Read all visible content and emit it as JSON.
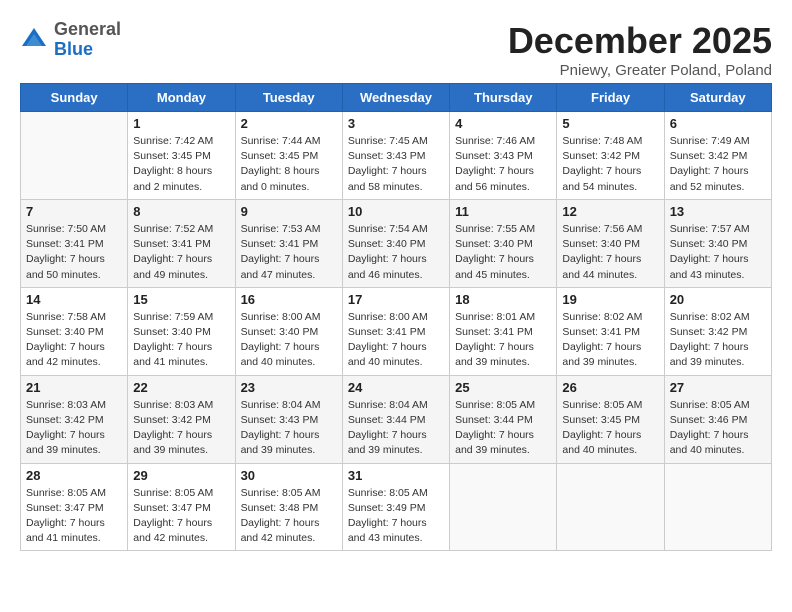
{
  "logo": {
    "general": "General",
    "blue": "Blue"
  },
  "header": {
    "month": "December 2025",
    "location": "Pniewy, Greater Poland, Poland"
  },
  "weekdays": [
    "Sunday",
    "Monday",
    "Tuesday",
    "Wednesday",
    "Thursday",
    "Friday",
    "Saturday"
  ],
  "weeks": [
    [
      {
        "day": "",
        "info": ""
      },
      {
        "day": "1",
        "info": "Sunrise: 7:42 AM\nSunset: 3:45 PM\nDaylight: 8 hours\nand 2 minutes."
      },
      {
        "day": "2",
        "info": "Sunrise: 7:44 AM\nSunset: 3:45 PM\nDaylight: 8 hours\nand 0 minutes."
      },
      {
        "day": "3",
        "info": "Sunrise: 7:45 AM\nSunset: 3:43 PM\nDaylight: 7 hours\nand 58 minutes."
      },
      {
        "day": "4",
        "info": "Sunrise: 7:46 AM\nSunset: 3:43 PM\nDaylight: 7 hours\nand 56 minutes."
      },
      {
        "day": "5",
        "info": "Sunrise: 7:48 AM\nSunset: 3:42 PM\nDaylight: 7 hours\nand 54 minutes."
      },
      {
        "day": "6",
        "info": "Sunrise: 7:49 AM\nSunset: 3:42 PM\nDaylight: 7 hours\nand 52 minutes."
      }
    ],
    [
      {
        "day": "7",
        "info": "Sunrise: 7:50 AM\nSunset: 3:41 PM\nDaylight: 7 hours\nand 50 minutes."
      },
      {
        "day": "8",
        "info": "Sunrise: 7:52 AM\nSunset: 3:41 PM\nDaylight: 7 hours\nand 49 minutes."
      },
      {
        "day": "9",
        "info": "Sunrise: 7:53 AM\nSunset: 3:41 PM\nDaylight: 7 hours\nand 47 minutes."
      },
      {
        "day": "10",
        "info": "Sunrise: 7:54 AM\nSunset: 3:40 PM\nDaylight: 7 hours\nand 46 minutes."
      },
      {
        "day": "11",
        "info": "Sunrise: 7:55 AM\nSunset: 3:40 PM\nDaylight: 7 hours\nand 45 minutes."
      },
      {
        "day": "12",
        "info": "Sunrise: 7:56 AM\nSunset: 3:40 PM\nDaylight: 7 hours\nand 44 minutes."
      },
      {
        "day": "13",
        "info": "Sunrise: 7:57 AM\nSunset: 3:40 PM\nDaylight: 7 hours\nand 43 minutes."
      }
    ],
    [
      {
        "day": "14",
        "info": "Sunrise: 7:58 AM\nSunset: 3:40 PM\nDaylight: 7 hours\nand 42 minutes."
      },
      {
        "day": "15",
        "info": "Sunrise: 7:59 AM\nSunset: 3:40 PM\nDaylight: 7 hours\nand 41 minutes."
      },
      {
        "day": "16",
        "info": "Sunrise: 8:00 AM\nSunset: 3:40 PM\nDaylight: 7 hours\nand 40 minutes."
      },
      {
        "day": "17",
        "info": "Sunrise: 8:00 AM\nSunset: 3:41 PM\nDaylight: 7 hours\nand 40 minutes."
      },
      {
        "day": "18",
        "info": "Sunrise: 8:01 AM\nSunset: 3:41 PM\nDaylight: 7 hours\nand 39 minutes."
      },
      {
        "day": "19",
        "info": "Sunrise: 8:02 AM\nSunset: 3:41 PM\nDaylight: 7 hours\nand 39 minutes."
      },
      {
        "day": "20",
        "info": "Sunrise: 8:02 AM\nSunset: 3:42 PM\nDaylight: 7 hours\nand 39 minutes."
      }
    ],
    [
      {
        "day": "21",
        "info": "Sunrise: 8:03 AM\nSunset: 3:42 PM\nDaylight: 7 hours\nand 39 minutes."
      },
      {
        "day": "22",
        "info": "Sunrise: 8:03 AM\nSunset: 3:42 PM\nDaylight: 7 hours\nand 39 minutes."
      },
      {
        "day": "23",
        "info": "Sunrise: 8:04 AM\nSunset: 3:43 PM\nDaylight: 7 hours\nand 39 minutes."
      },
      {
        "day": "24",
        "info": "Sunrise: 8:04 AM\nSunset: 3:44 PM\nDaylight: 7 hours\nand 39 minutes."
      },
      {
        "day": "25",
        "info": "Sunrise: 8:05 AM\nSunset: 3:44 PM\nDaylight: 7 hours\nand 39 minutes."
      },
      {
        "day": "26",
        "info": "Sunrise: 8:05 AM\nSunset: 3:45 PM\nDaylight: 7 hours\nand 40 minutes."
      },
      {
        "day": "27",
        "info": "Sunrise: 8:05 AM\nSunset: 3:46 PM\nDaylight: 7 hours\nand 40 minutes."
      }
    ],
    [
      {
        "day": "28",
        "info": "Sunrise: 8:05 AM\nSunset: 3:47 PM\nDaylight: 7 hours\nand 41 minutes."
      },
      {
        "day": "29",
        "info": "Sunrise: 8:05 AM\nSunset: 3:47 PM\nDaylight: 7 hours\nand 42 minutes."
      },
      {
        "day": "30",
        "info": "Sunrise: 8:05 AM\nSunset: 3:48 PM\nDaylight: 7 hours\nand 42 minutes."
      },
      {
        "day": "31",
        "info": "Sunrise: 8:05 AM\nSunset: 3:49 PM\nDaylight: 7 hours\nand 43 minutes."
      },
      {
        "day": "",
        "info": ""
      },
      {
        "day": "",
        "info": ""
      },
      {
        "day": "",
        "info": ""
      }
    ]
  ]
}
